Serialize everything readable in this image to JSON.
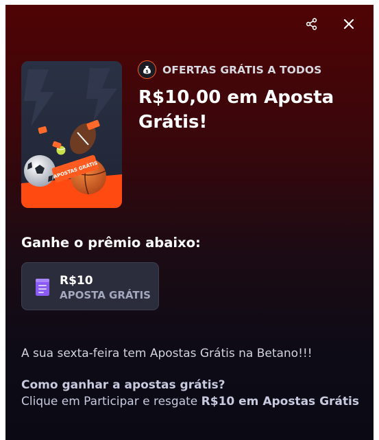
{
  "header": {
    "share_icon": "share-icon",
    "close_icon": "close-icon"
  },
  "offer": {
    "tag_icon": "money-bag-icon",
    "tag_label": "OFERTAS GRÁTIS A TODOS",
    "title": "R$10,00 em Aposta Grátis!",
    "image_ticket_text": "APOSTAS GRÁTIS"
  },
  "prize": {
    "heading": "Ganhe o prêmio abaixo:",
    "icon": "ticket-icon",
    "amount": "R$10",
    "type": "APOSTA GRÁTIS"
  },
  "description": {
    "intro": "A sua sexta-feira tem Apostas Grátis na Betano!!!",
    "howto_heading": "Como ganhar a apostas grátis?",
    "howto_text": "Clique em Participar e resgate ",
    "howto_bold": "R$10 em Apostas Grátis"
  },
  "colors": {
    "accent": "#ff5a1f",
    "prize_icon": "#8a5cf5",
    "background_top": "#4f0304",
    "background_bottom": "#0b0a14"
  }
}
